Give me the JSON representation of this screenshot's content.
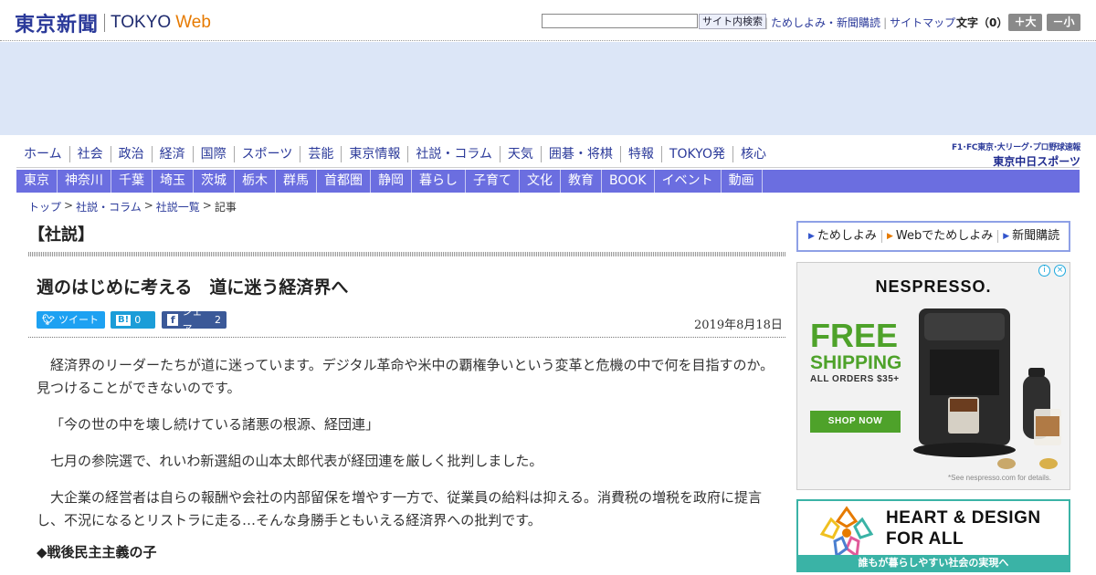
{
  "header": {
    "logo_jp": "東京新聞",
    "logo_tokyo": "TOKYO",
    "logo_web": "Web",
    "search_value": "",
    "search_button": "サイト内検索",
    "links": [
      "ためしよみ・新聞購読",
      "サイトマップ"
    ],
    "font_size_label": "文字（0）",
    "font_larger": "＋大",
    "font_smaller": "－小"
  },
  "main_nav": [
    "ホーム",
    "社会",
    "政治",
    "経済",
    "国際",
    "スポーツ",
    "芸能",
    "東京情報",
    "社説・コラム",
    "天気",
    "囲碁・将棋",
    "特報",
    "TOKYO発",
    "核心"
  ],
  "promo": {
    "line1": "F1･FC東京･大リーグ･プロ野球速報",
    "line2": "東京中日スポーツ"
  },
  "region_nav": [
    "東京",
    "神奈川",
    "千葉",
    "埼玉",
    "茨城",
    "栃木",
    "群馬",
    "首都圏",
    "静岡",
    "暮らし",
    "子育て",
    "文化",
    "教育",
    "BOOK",
    "イベント",
    "動画"
  ],
  "breadcrumb": [
    "トップ",
    "社説・コラム",
    "社説一覧",
    "記事"
  ],
  "article": {
    "section": "【社説】",
    "title": "週のはじめに考える　道に迷う経済界へ",
    "share": {
      "tweet": "ツイート",
      "hatena_icon": "B!",
      "hatena_count": "0",
      "facebook_icon": "f",
      "facebook_label": "シェア",
      "facebook_count": "2"
    },
    "date": "2019年8月18日",
    "paragraphs": [
      "経済界のリーダーたちが道に迷っています。デジタル革命や米中の覇権争いという変革と危機の中で何を目指すのか。見つけることができないのです。",
      "「今の世の中を壊し続けている諸悪の根源、経団連」",
      "七月の参院選で、れいわ新選組の山本太郎代表が経団連を厳しく批判しました。",
      "大企業の経営者は自らの報酬や会社の内部留保を増やす一方で、従業員の給料は抑える。消費税の増税を政府に提言し、不況になるとリストラに走る…そんな身勝手ともいえる経済界への批判です。"
    ],
    "subheading": "◆戦後民主主義の子"
  },
  "sidebar": {
    "links": [
      "ためしよみ",
      "Webでためしよみ",
      "新聞購読"
    ],
    "ad1": {
      "brand": "NESPRESSO.",
      "headline1": "FREE",
      "headline2": "SHIPPING",
      "subline": "ALL ORDERS $35+",
      "cta": "SHOP NOW",
      "note": "*See nespresso.com for details.",
      "green": "#4ea22a"
    },
    "ad2": {
      "line1": "HEART & DESIGN",
      "line2": "FOR ALL",
      "caption": "誰もが暮らしやすい社会の実現へ",
      "teal": "#3ab3a6"
    }
  },
  "colors": {
    "nav_text": "#2b3a9a",
    "region_bg": "#6b6ee0",
    "accent_orange": "#e67a00"
  }
}
